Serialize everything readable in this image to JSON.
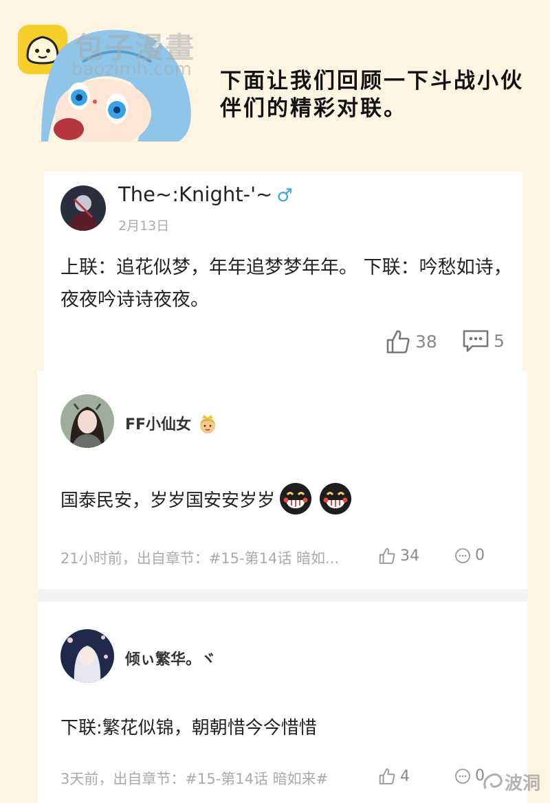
{
  "header": {
    "watermark_title": "包子漫畫",
    "watermark_url": "baozimh.com",
    "intro_text": "下面让我们回顾一下斗战小伙伴们的精彩对联。"
  },
  "comments": [
    {
      "username": "The~:Knight-'~",
      "gender_symbol": "♂",
      "date": "2月13日",
      "content": "上联：追花似梦，年年追梦梦年年。 下联：吟愁如诗，夜夜吟诗诗夜夜。",
      "likes": "38",
      "replies": "5"
    },
    {
      "username": "FF小仙女",
      "content": "国泰民安，岁岁国安安岁岁",
      "meta": "21小时前，出自章节：#15-第14话 暗如...",
      "likes": "34",
      "replies": "0"
    },
    {
      "username": "倾ぃ繁华。ヾ",
      "content": "下联:繁花似锦，朝朝惜今今惜惜",
      "meta": "3天前，出自章节：#15-第14话 暗如来#",
      "likes": "4",
      "replies": "0"
    }
  ],
  "footer_watermark": "波洞",
  "colors": {
    "page_bg": "#fdf5e2",
    "logo_yellow": "#f7cf2a",
    "gender_blue": "#3aa3e8",
    "meta_gray": "#aaaaaa"
  },
  "icons": [
    "bun-logo-icon",
    "thumb-up-icon",
    "comment-bubble-icon",
    "laughing-face-icon",
    "crown-girl-emoji-icon"
  ]
}
